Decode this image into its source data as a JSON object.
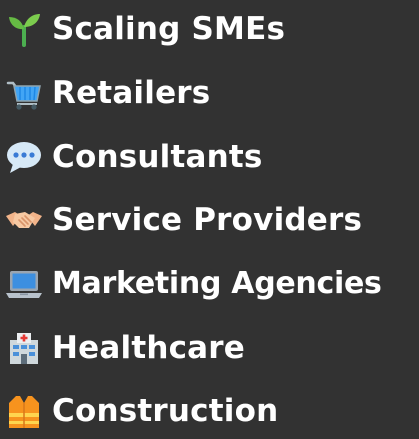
{
  "items": [
    {
      "label": "Scaling SMEs",
      "icon": "seedling-icon"
    },
    {
      "label": "Retailers",
      "icon": "shopping-cart-icon"
    },
    {
      "label": "Consultants",
      "icon": "speech-bubble-icon"
    },
    {
      "label": "Service Providers",
      "icon": "handshake-icon"
    },
    {
      "label": "Marketing Agencies",
      "icon": "laptop-icon"
    },
    {
      "label": "Healthcare",
      "icon": "hospital-icon"
    },
    {
      "label": "Construction",
      "icon": "safety-vest-icon"
    }
  ],
  "colors": {
    "background": "#323232",
    "text": "#ffffff"
  }
}
